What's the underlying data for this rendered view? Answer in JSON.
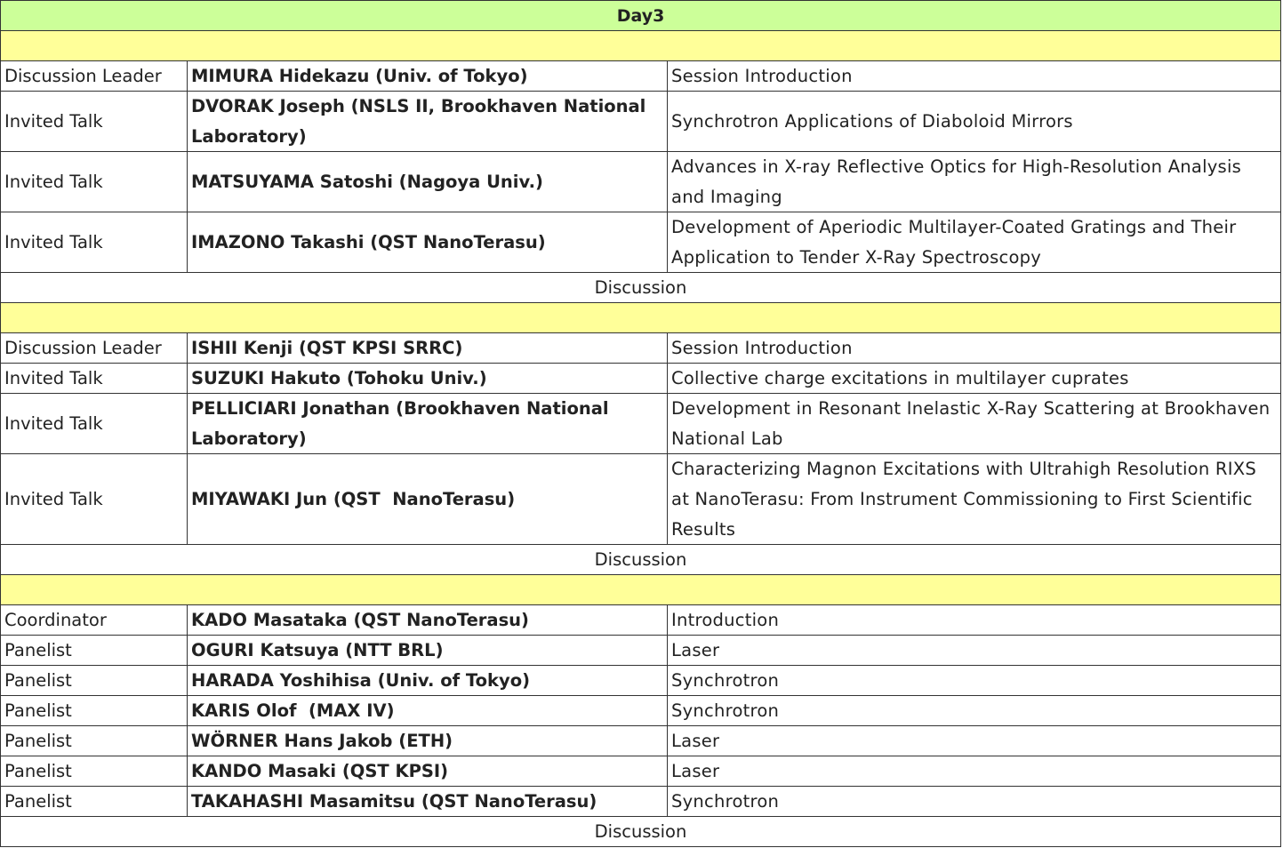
{
  "header": {
    "title": "Day3"
  },
  "sessions": [
    {
      "rows": [
        {
          "role": "Discussion Leader",
          "speaker": "MIMURA Hidekazu (Univ. of Tokyo)",
          "talk": "Session Introduction"
        },
        {
          "role": "Invited Talk",
          "speaker": "DVORAK Joseph (NSLS II, Brookhaven National Laboratory)",
          "talk": "Synchrotron Applications of Diaboloid Mirrors"
        },
        {
          "role": "Invited Talk",
          "speaker": "MATSUYAMA Satoshi (Nagoya Univ.)",
          "talk": "Advances in X-ray Reflective Optics for High-Resolution Analysis and Imaging"
        },
        {
          "role": "Invited Talk",
          "speaker": "IMAZONO Takashi (QST NanoTerasu)",
          "talk": "Development of Aperiodic Multilayer-Coated Gratings and Their Application to Tender X-Ray Spectroscopy"
        }
      ],
      "closing": "Discussion"
    },
    {
      "rows": [
        {
          "role": "Discussion Leader",
          "speaker": "ISHII Kenji (QST KPSI SRRC)",
          "talk": "Session Introduction"
        },
        {
          "role": "Invited Talk",
          "speaker": "SUZUKI Hakuto (Tohoku Univ.)",
          "talk": "Collective charge excitations in multilayer cuprates"
        },
        {
          "role": "Invited Talk",
          "speaker": "PELLICIARI Jonathan (Brookhaven National Laboratory)",
          "talk": "Development in Resonant Inelastic X-Ray Scattering at Brookhaven National Lab"
        },
        {
          "role": "Invited Talk",
          "speaker": "MIYAWAKI Jun (QST  NanoTerasu)",
          "talk": "Characterizing Magnon Excitations with Ultrahigh Resolution RIXS at NanoTerasu: From Instrument Commissioning to First Scientific Results"
        }
      ],
      "closing": "Discussion"
    },
    {
      "rows": [
        {
          "role": "Coordinator",
          "speaker": "KADO Masataka (QST NanoTerasu)",
          "talk": "Introduction"
        },
        {
          "role": "Panelist",
          "speaker": "OGURI Katsuya (NTT BRL)",
          "talk": "Laser"
        },
        {
          "role": "Panelist",
          "speaker": "HARADA Yoshihisa (Univ. of Tokyo)",
          "talk": "Synchrotron"
        },
        {
          "role": "Panelist",
          "speaker": "KARIS Olof  (MAX IV)",
          "talk": "Synchrotron"
        },
        {
          "role": "Panelist",
          "speaker": "WÖRNER Hans Jakob (ETH)",
          "talk": "Laser"
        },
        {
          "role": "Panelist",
          "speaker": "KANDO Masaki (QST KPSI)",
          "talk": "Laser"
        },
        {
          "role": "Panelist",
          "speaker": "TAKAHASHI Masamitsu (QST NanoTerasu)",
          "talk": "Synchrotron"
        }
      ],
      "closing": "Discussion"
    }
  ]
}
